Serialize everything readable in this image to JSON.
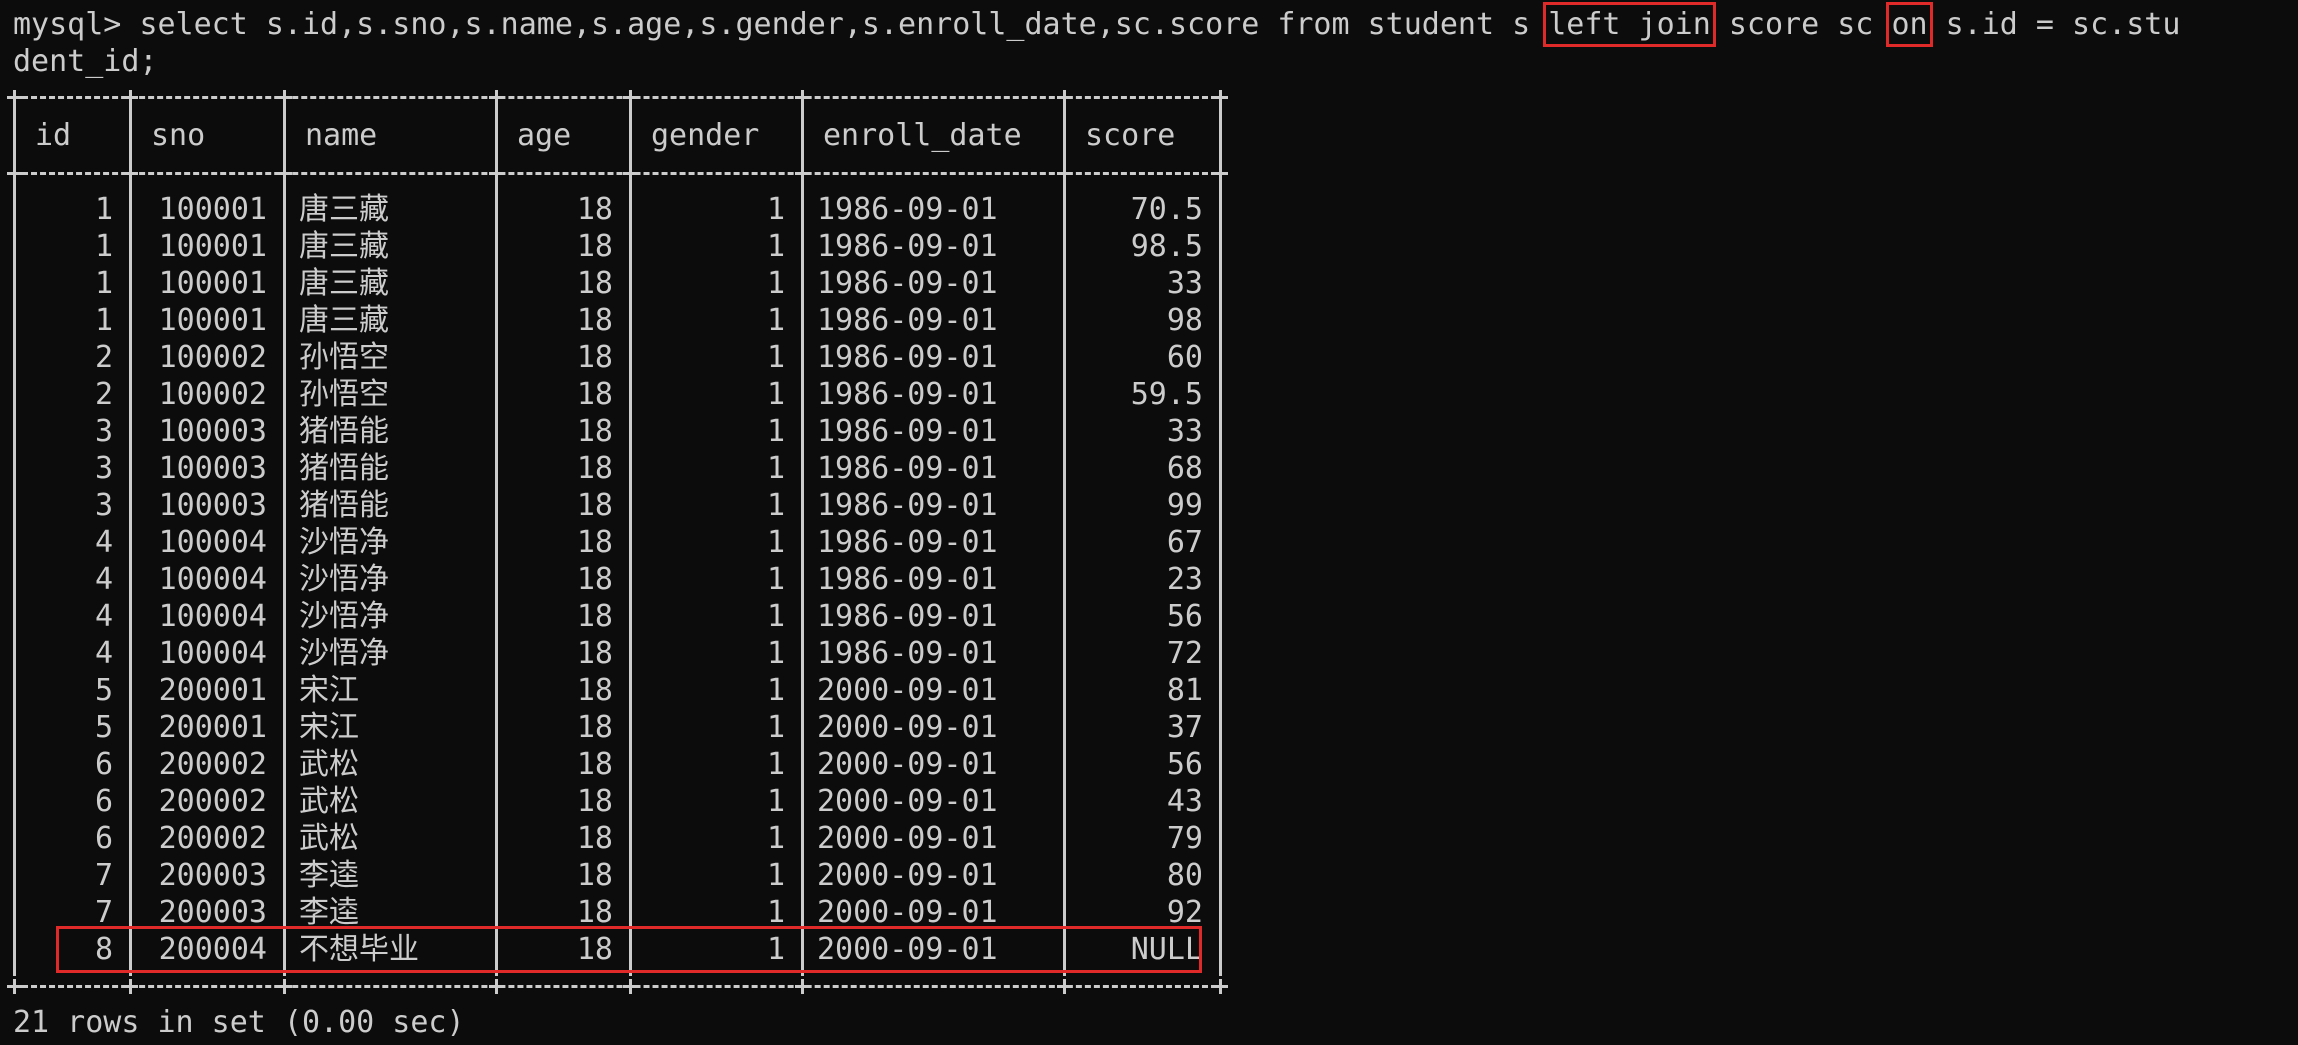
{
  "command": {
    "prompt": "mysql>",
    "seg1": "select s.id,s.sno,s.name,s.age,s.gender,s.enroll_date,sc.score from student s",
    "kw_left_join": "left join",
    "seg2": "score sc",
    "kw_on": "on",
    "seg3": "s.id = sc.stu",
    "wrap": "dent_id;"
  },
  "table": {
    "headers": [
      "id",
      "sno",
      "name",
      "age",
      "gender",
      "enroll_date",
      "score"
    ],
    "rows": [
      [
        "1",
        "100001",
        "唐三藏",
        "18",
        "1",
        "1986-09-01",
        "70.5"
      ],
      [
        "1",
        "100001",
        "唐三藏",
        "18",
        "1",
        "1986-09-01",
        "98.5"
      ],
      [
        "1",
        "100001",
        "唐三藏",
        "18",
        "1",
        "1986-09-01",
        "33"
      ],
      [
        "1",
        "100001",
        "唐三藏",
        "18",
        "1",
        "1986-09-01",
        "98"
      ],
      [
        "2",
        "100002",
        "孙悟空",
        "18",
        "1",
        "1986-09-01",
        "60"
      ],
      [
        "2",
        "100002",
        "孙悟空",
        "18",
        "1",
        "1986-09-01",
        "59.5"
      ],
      [
        "3",
        "100003",
        "猪悟能",
        "18",
        "1",
        "1986-09-01",
        "33"
      ],
      [
        "3",
        "100003",
        "猪悟能",
        "18",
        "1",
        "1986-09-01",
        "68"
      ],
      [
        "3",
        "100003",
        "猪悟能",
        "18",
        "1",
        "1986-09-01",
        "99"
      ],
      [
        "4",
        "100004",
        "沙悟净",
        "18",
        "1",
        "1986-09-01",
        "67"
      ],
      [
        "4",
        "100004",
        "沙悟净",
        "18",
        "1",
        "1986-09-01",
        "23"
      ],
      [
        "4",
        "100004",
        "沙悟净",
        "18",
        "1",
        "1986-09-01",
        "56"
      ],
      [
        "4",
        "100004",
        "沙悟净",
        "18",
        "1",
        "1986-09-01",
        "72"
      ],
      [
        "5",
        "200001",
        "宋江",
        "18",
        "1",
        "2000-09-01",
        "81"
      ],
      [
        "5",
        "200001",
        "宋江",
        "18",
        "1",
        "2000-09-01",
        "37"
      ],
      [
        "6",
        "200002",
        "武松",
        "18",
        "1",
        "2000-09-01",
        "56"
      ],
      [
        "6",
        "200002",
        "武松",
        "18",
        "1",
        "2000-09-01",
        "43"
      ],
      [
        "6",
        "200002",
        "武松",
        "18",
        "1",
        "2000-09-01",
        "79"
      ],
      [
        "7",
        "200003",
        "李逵",
        "18",
        "1",
        "2000-09-01",
        "80"
      ],
      [
        "7",
        "200003",
        "李逵",
        "18",
        "1",
        "2000-09-01",
        "92"
      ],
      [
        "8",
        "200004",
        "不想毕业",
        "18",
        "1",
        "2000-09-01",
        "NULL"
      ]
    ]
  },
  "footer": "21 rows in set (0.00 sec)",
  "colors": {
    "background": "#0c0c0c",
    "text": "#cccccc",
    "highlight_border": "#e02a2a"
  }
}
